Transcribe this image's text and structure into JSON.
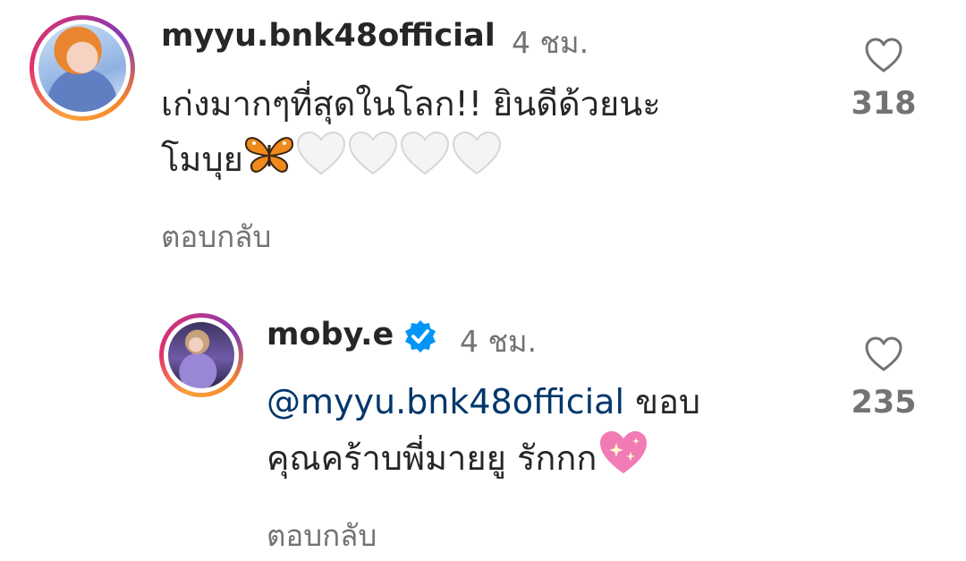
{
  "comments": [
    {
      "username": "myyu.bnk48official",
      "time": "4 ชม.",
      "line1": "เก่งมากๆที่สุดในโลก!! ยินดีด้วยนะ",
      "line2": "โมบุย",
      "emoji_names": [
        "butterfly-emoji",
        "white-heart-emoji",
        "white-heart-emoji",
        "white-heart-emoji",
        "white-heart-emoji"
      ],
      "reply_label": "ตอบกลับ",
      "likes": "318",
      "avatar_icon": "profile-photo"
    },
    {
      "username": "moby.e",
      "verified": true,
      "time": "4 ชม.",
      "mention": "@myyu.bnk48official",
      "text_after_mention": " ขอบ",
      "line2": "คุณคร้าบพี่มายยู รักกก",
      "emoji_names": [
        "sparkling-heart-emoji"
      ],
      "reply_label": "ตอบกลับ",
      "likes": "235",
      "avatar_icon": "profile-photo"
    }
  ],
  "colors": {
    "text": "#262626",
    "secondary": "#737373",
    "mention": "#00376b",
    "verified": "#0095f6"
  }
}
